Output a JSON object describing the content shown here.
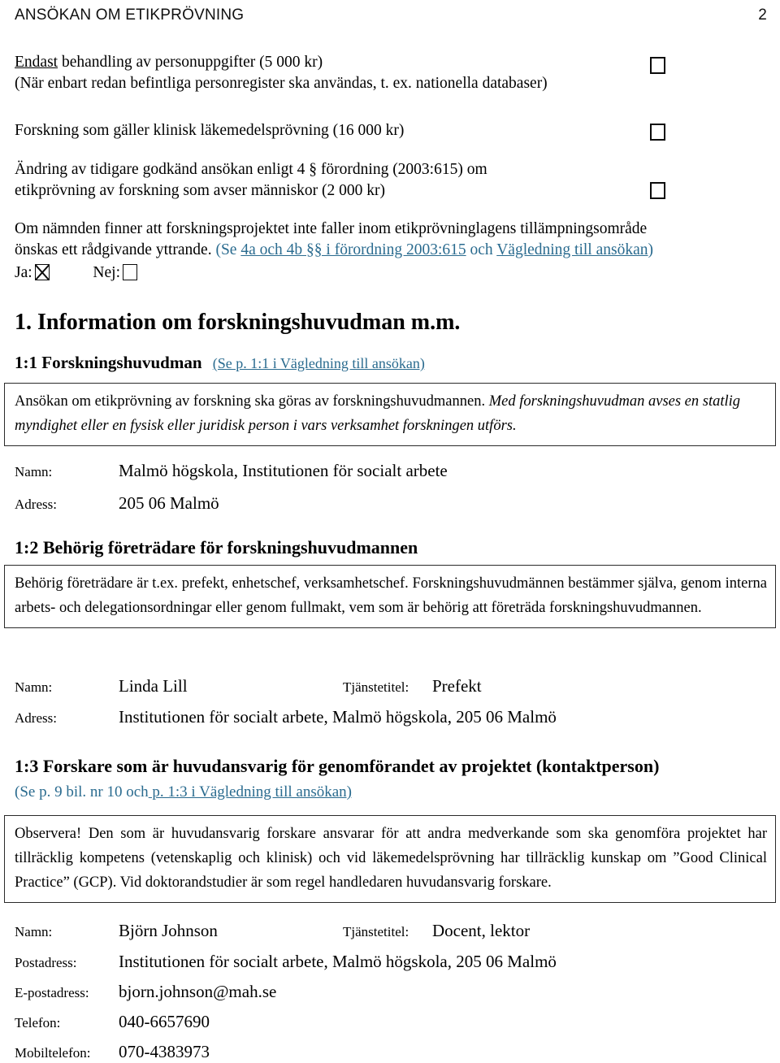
{
  "header": {
    "title": "ANSÖKAN OM ETIKPRÖVNING",
    "page_number": "2"
  },
  "fee_options": [
    {
      "id": "personuppgifter",
      "lines": [
        "Endast behandling av personuppgifter (5 000 kr)",
        "(När enbart redan befintliga personregister ska användas, t. ex. nationella databaser)"
      ],
      "underlined_word": "Endast",
      "checked": false
    },
    {
      "id": "lakemedelsprovning",
      "lines": [
        "Forskning som gäller klinisk läkemedelsprövning (16 000 kr)"
      ],
      "checked": false
    },
    {
      "id": "andring",
      "lines": [
        "Ändring av tidigare godkänd ansökan enligt 4 § förordning (2003:615) om",
        "etikprövning av forskning som avser människor (2 000 kr)"
      ],
      "checked": false
    }
  ],
  "advisory": {
    "line1": "Om nämnden finner att forskningsprojektet inte faller inom etikprövninglagens tillämpningsområde",
    "line2_text": "önskas ett rådgivande yttrande.",
    "ref_open": "(Se",
    "ref_link1": "4a och 4b §§ i förordning 2003:615",
    "ref_mid": "och",
    "ref_link2": "Vägledning till ansökan",
    "ref_close": ")",
    "yes_label": "Ja:",
    "yes_checked": true,
    "no_label": "Nej:",
    "no_checked": false
  },
  "section1": {
    "title": "1. Information om forskningshuvudman m.m."
  },
  "section11": {
    "heading": "1:1 Forskningshuvudman",
    "ref": "(Se p. 1:1 i Vägledning till ansökan)",
    "note_part1": "Ansökan om etikprövning av forskning ska göras av forskningshuvudmannen.",
    "note_part2_italic": "Med forskningshuvudman avses en statlig myndighet eller en fysisk eller juridisk person i vars verksamhet forskningen utförs.",
    "fields": [
      {
        "label": "Namn:",
        "value": "Malmö högskola, Institutionen för  socialt arbete"
      },
      {
        "label": "Adress:",
        "value": "205 06 Malmö"
      }
    ]
  },
  "section12": {
    "heading": "1:2 Behörig företrädare för forskningshuvudmannen",
    "note": "Behörig företrädare är t.ex. prefekt, enhetschef, verksamhetschef. Forskningshuvudmännen bestämmer själva, genom interna arbets- och delegationsordningar eller genom fullmakt, vem som är behörig att företräda forskningshuvudmannen.",
    "name_label": "Namn:",
    "name_value": "Linda Lill",
    "title_label": "Tjänstetitel:",
    "title_value": "Prefekt",
    "address_label": "Adress:",
    "address_value": "Institutionen för socialt arbete, Malmö högskola, 205 06 Malmö"
  },
  "section13": {
    "heading": "1:3 Forskare som är huvudansvarig för genomförandet av projektet (kontaktperson)",
    "ref_plain": "(Se p. 9 bil. nr 10 och",
    "ref_link": " p. 1:3 i Vägledning till ansökan)",
    "note": "Observera! Den som är huvudansvarig forskare ansvarar för att andra medverkande som ska genomföra projektet har tillräcklig kompetens (vetenskaplig och klinisk) och vid läkemedelsprövning har tillräcklig kunskap om ”Good Clinical Practice” (GCP). Vid doktorandstudier är som regel handledaren huvudansvarig forskare.",
    "name_label": "Namn:",
    "name_value": "Björn Johnson",
    "title_label": "Tjänstetitel:",
    "title_value": "Docent, lektor",
    "rows": [
      {
        "label": "Postadress:",
        "value": "Institutionen för socialt arbete, Malmö högskola, 205 06 Malmö"
      },
      {
        "label": "E-postadress:",
        "value": "bjorn.johnson@mah.se"
      },
      {
        "label": "Telefon:",
        "value": "040-6657690"
      },
      {
        "label": "Mobiltelefon:",
        "value": "070-4383973"
      }
    ]
  },
  "colors": {
    "link": "#2a6b8f",
    "text": "#000000",
    "border": "#2a2a2a"
  }
}
